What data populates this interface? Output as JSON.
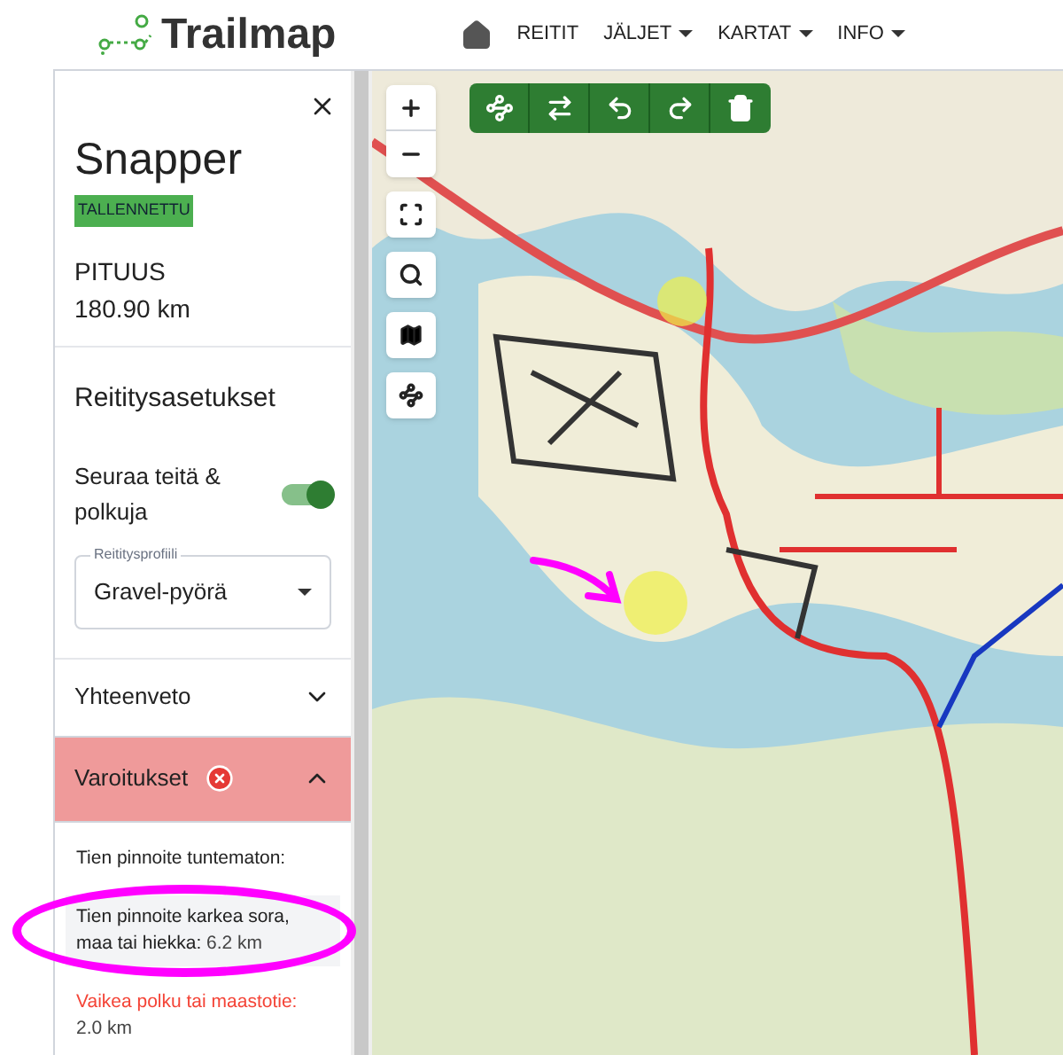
{
  "header": {
    "brand": "Trailmap",
    "nav": [
      {
        "label": "REITIT",
        "dropdown": false
      },
      {
        "label": "JÄLJET",
        "dropdown": true
      },
      {
        "label": "KARTAT",
        "dropdown": true
      },
      {
        "label": "INFO",
        "dropdown": true
      }
    ]
  },
  "route": {
    "name": "Snapper",
    "status": "TALLENNETTU",
    "length_label": "PITUUS",
    "length": "180.90 km"
  },
  "settings": {
    "title": "Reititysasetukset",
    "follow": {
      "label": "Seuraa teitä & polkuja",
      "on": true
    },
    "profile": {
      "label": "Reititysprofiili",
      "value": "Gravel-pyörä"
    }
  },
  "sections": [
    {
      "title": "Yhteenveto",
      "expanded": false,
      "warning": false
    },
    {
      "title": "Varoitukset",
      "expanded": true,
      "warning": true
    }
  ],
  "warnings": [
    {
      "label": "Tien pinnoite tuntematon:",
      "severe": false,
      "highlighted": false
    },
    {
      "label": "Tien pinnoite karkea sora, maa tai hiekka:",
      "value": "6.2 km",
      "severe": false,
      "highlighted": true
    },
    {
      "label": "Vaikea polku tai maastotie:",
      "value": "2.0 km",
      "severe": true,
      "highlighted": false
    }
  ]
}
